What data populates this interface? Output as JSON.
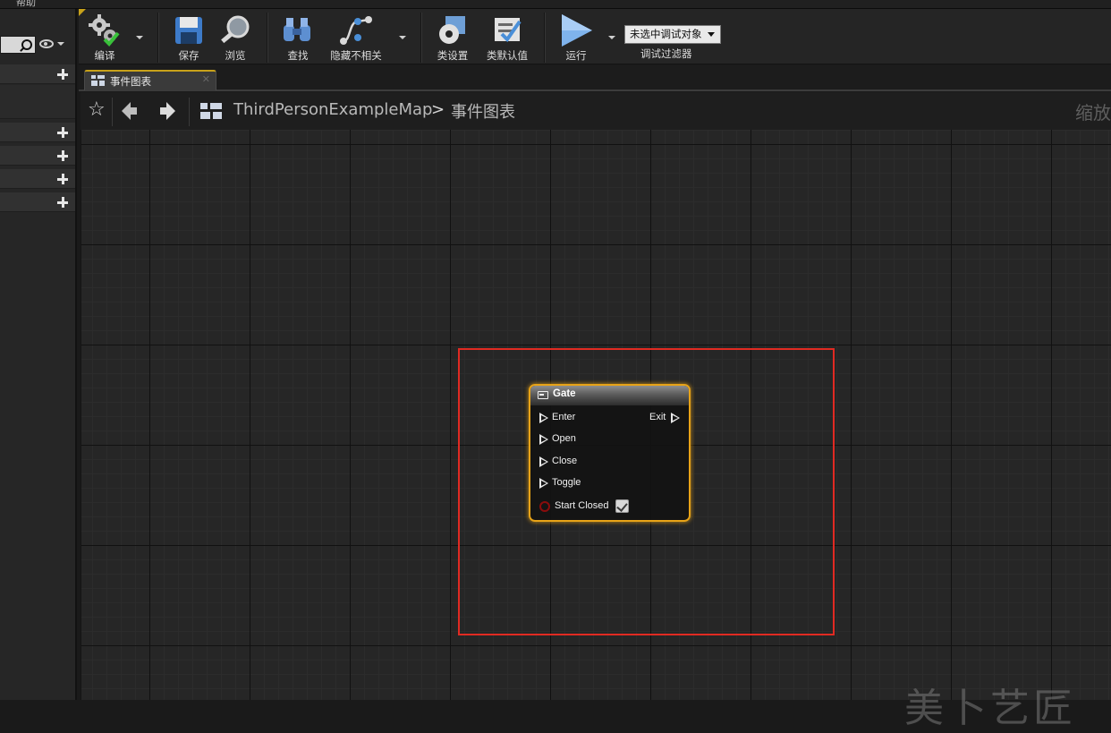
{
  "menubar": {
    "help_label": "帮助"
  },
  "toolbar": {
    "compile_label": "编译",
    "save_label": "保存",
    "browse_label": "浏览",
    "find_label": "查找",
    "hide_unrelated_label": "隐藏不相关",
    "class_settings_label": "类设置",
    "class_defaults_label": "类默认值",
    "run_label": "运行",
    "debug_object_value": "未选中调试对象",
    "debug_filter_label": "调试过滤器"
  },
  "tabs": [
    {
      "label": "事件图表",
      "close_glyph": "✕"
    }
  ],
  "breadcrumb": {
    "map_name": "ThirdPersonExampleMap",
    "separator": ">",
    "graph_name": "事件图表",
    "zoom_label": "缩放"
  },
  "node": {
    "title": "Gate",
    "inputs": [
      "Enter",
      "Open",
      "Close",
      "Toggle"
    ],
    "outputs": [
      "Exit"
    ],
    "bool_pin_label": "Start Closed",
    "bool_pin_checked": true,
    "border_color": "#e8a317"
  },
  "watermark": "美卜艺匠",
  "colors": {
    "highlight_box": "#e12a22",
    "accent_gold": "#c8a21a",
    "bool_pin": "#8a0c0c"
  },
  "icons": [
    "compile-icon",
    "save-icon",
    "browse-icon",
    "find-icon",
    "hide-unrelated-icon",
    "class-settings-icon",
    "class-defaults-icon",
    "play-icon",
    "star-icon",
    "back-arrow-icon",
    "forward-arrow-icon",
    "graph-icon",
    "search-icon",
    "eye-icon",
    "plus-icon"
  ]
}
